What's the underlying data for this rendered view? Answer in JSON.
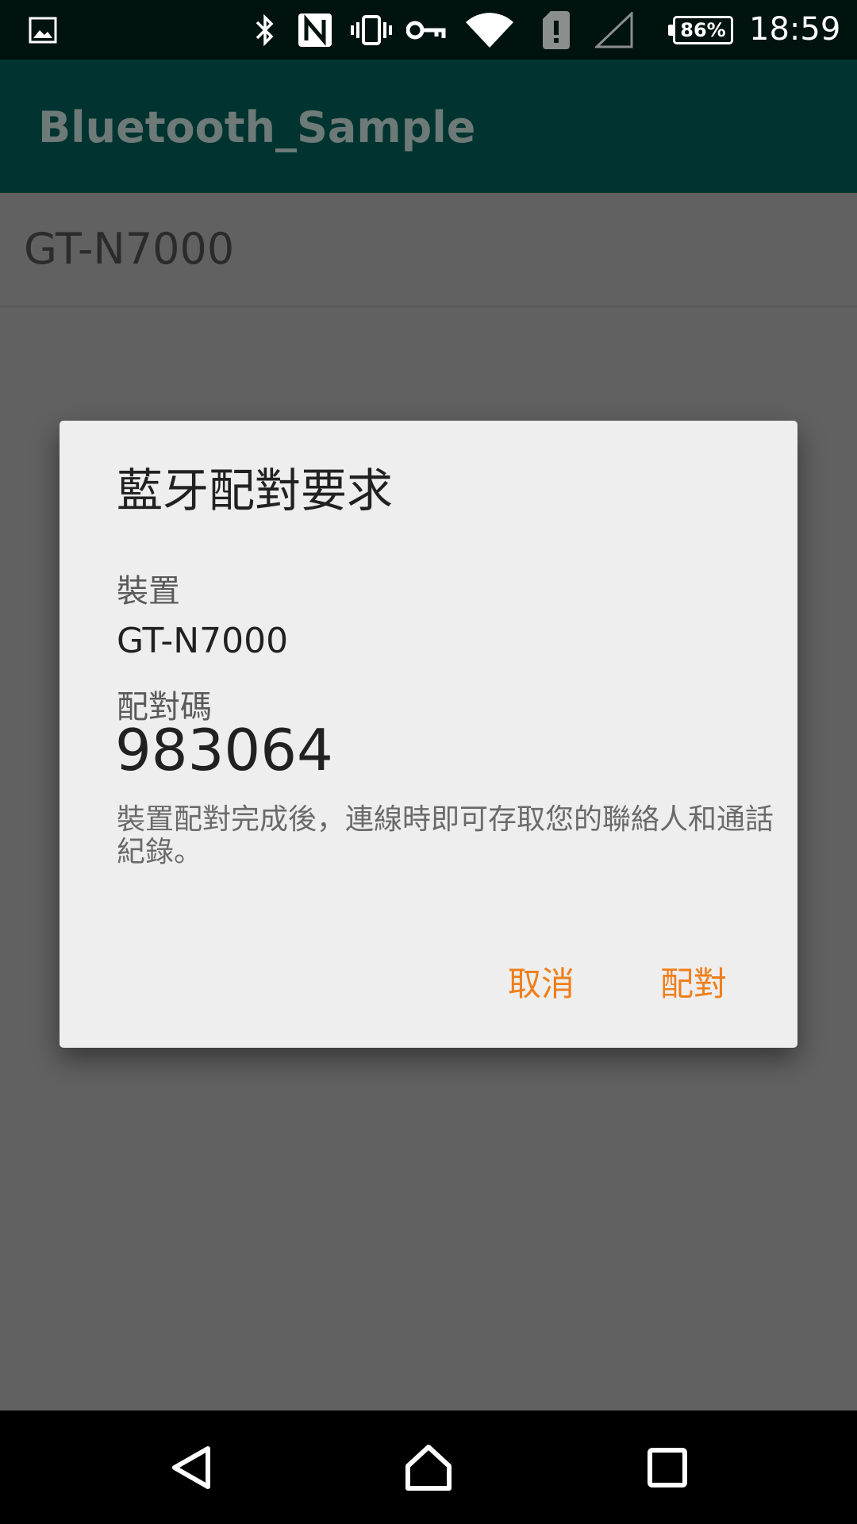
{
  "status_bar": {
    "icons": [
      "image-icon",
      "bluetooth-icon",
      "nfc-icon",
      "vibrate-icon",
      "vpn-key-icon",
      "wifi-icon",
      "sim-alert-icon",
      "signal-icon"
    ],
    "battery_percent": "86%",
    "time": "18:59"
  },
  "app_bar": {
    "title": "Bluetooth_Sample"
  },
  "device_list": {
    "items": [
      {
        "name": "GT-N7000"
      }
    ]
  },
  "dialog": {
    "title": "藍牙配對要求",
    "device_label": "裝置",
    "device_name": "GT-N7000",
    "code_label": "配對碼",
    "pairing_code": "983064",
    "message": "裝置配對完成後，連線時即可存取您的聯絡人和通話紀錄。",
    "cancel_label": "取消",
    "pair_label": "配對",
    "accent_color": "#ef7f1b"
  },
  "nav_bar": {
    "icons": [
      "back-icon",
      "home-icon",
      "recents-icon"
    ]
  }
}
